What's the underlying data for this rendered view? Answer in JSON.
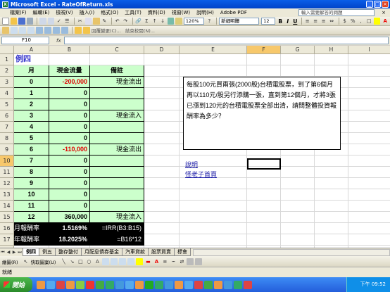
{
  "window": {
    "title": "Microsoft Excel - RateOfReturn.xls"
  },
  "menu": [
    "檔案(F)",
    "編輯(E)",
    "檢視(V)",
    "插入(I)",
    "格式(O)",
    "工具(T)",
    "資料(D)",
    "視窗(W)",
    "說明(H)",
    "Adobe PDF"
  ],
  "help_box": "輸入需要解答的問題",
  "toolbar": {
    "zoom": "120%",
    "font": "新細明體",
    "font_size": "12",
    "bold": "B",
    "italic": "I",
    "underline": "U",
    "review_reply": "回覆變更(C)...",
    "review_end": "結束校閱(N)..."
  },
  "formula_bar": {
    "name_box": "F10",
    "fx": "fx",
    "content": ""
  },
  "columns": [
    "A",
    "B",
    "C",
    "D",
    "E",
    "F",
    "G",
    "H",
    "I"
  ],
  "selected_column": "F",
  "rows": [
    "1",
    "2",
    "3",
    "4",
    "5",
    "6",
    "7",
    "8",
    "9",
    "10",
    "11",
    "12",
    "13",
    "14",
    "15",
    "16",
    "17",
    "18",
    "19"
  ],
  "selected_row": "10",
  "sheet": {
    "title": "例四",
    "headers": {
      "month": "月",
      "cashflow": "現金流量",
      "note": "備註"
    },
    "data": [
      {
        "month": "0",
        "cashflow": "-200,000",
        "note": "現金流出",
        "negative": true
      },
      {
        "month": "1",
        "cashflow": "0",
        "note": ""
      },
      {
        "month": "2",
        "cashflow": "0",
        "note": ""
      },
      {
        "month": "3",
        "cashflow": "0",
        "note": "現金流入"
      },
      {
        "month": "4",
        "cashflow": "0",
        "note": ""
      },
      {
        "month": "5",
        "cashflow": "0",
        "note": ""
      },
      {
        "month": "6",
        "cashflow": "-110,000",
        "note": "現金流出",
        "negative": true
      },
      {
        "month": "7",
        "cashflow": "0",
        "note": ""
      },
      {
        "month": "8",
        "cashflow": "0",
        "note": ""
      },
      {
        "month": "9",
        "cashflow": "0",
        "note": ""
      },
      {
        "month": "10",
        "cashflow": "0",
        "note": ""
      },
      {
        "month": "11",
        "cashflow": "0",
        "note": ""
      },
      {
        "month": "12",
        "cashflow": "360,000",
        "note": "現金流入"
      }
    ],
    "summary": [
      {
        "label": "月報酬率",
        "value": "1.5169%",
        "formula": "=IRR(B3:B15)"
      },
      {
        "label": "年報酬率",
        "value": "18.2025%",
        "formula": "=B16*12"
      }
    ],
    "problem_text": "每股100元買兩張(2000股)台積電股票，到了第6個月再以110元/股另行添購一張，直到第12個月，才將3張已漲到120元的台積電股票全部出清，請問整體投資報酬率為多少？",
    "links": [
      "說明",
      "怪老子首頁"
    ]
  },
  "tabs": [
    "例四",
    "例五",
    "整存整付",
    "月配息債券基金",
    "汽車貸款",
    "股票買賣",
    "標會"
  ],
  "active_tab": "例四",
  "drawbar": {
    "draw": "繪圖(R)",
    "autoshape": "快取圖案(U)"
  },
  "status": "就緒",
  "taskbar": {
    "start": "開始",
    "clock": "下午 09:52"
  },
  "colors": {
    "green_fill": "#ccffcc",
    "negative": "#e00000",
    "title_blue": "#3333cc",
    "selection": "#f7c86b"
  }
}
